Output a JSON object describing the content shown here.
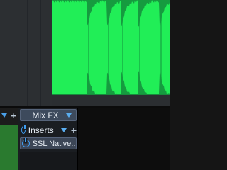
{
  "arrange": {
    "clip_color": "#21ee57",
    "clip_wave_color": "#169b3f",
    "lane_color": "#2c2f32"
  },
  "console": {
    "mix_fx": {
      "label": "Mix FX"
    },
    "inserts": {
      "label": "Inserts"
    },
    "insert_slots": [
      {
        "label": "SSL Native..."
      }
    ],
    "accent_color": "#3f9df0"
  }
}
